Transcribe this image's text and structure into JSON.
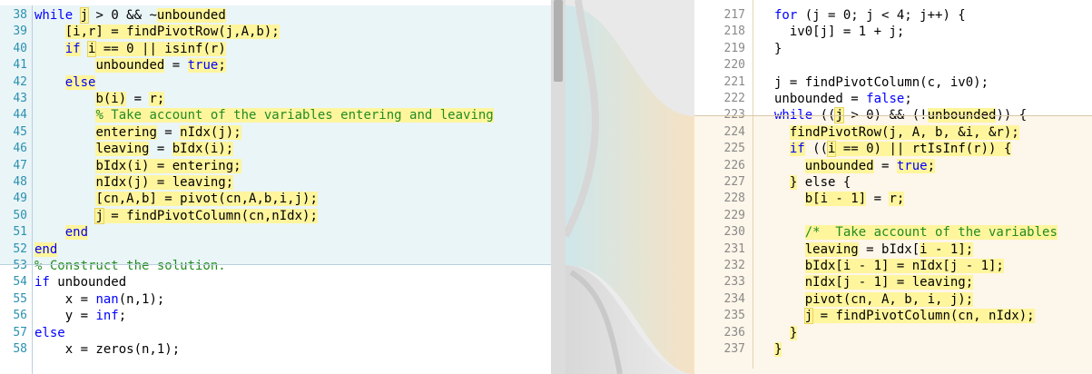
{
  "left_pane": {
    "lines": [
      {
        "n": "38",
        "parts": [
          {
            "t": "while",
            "c": "kw"
          },
          {
            "t": " "
          },
          {
            "t": "j",
            "c": "y ol"
          },
          {
            "t": " > 0 && ~"
          },
          {
            "t": "unbounded",
            "c": "y"
          }
        ]
      },
      {
        "n": "39",
        "parts": [
          {
            "t": "    "
          },
          {
            "t": "[i,r] = findPivotRow(j,A,b);",
            "c": "y"
          }
        ]
      },
      {
        "n": "40",
        "parts": [
          {
            "t": "    "
          },
          {
            "t": "if",
            "c": "kw y"
          },
          {
            "t": " "
          },
          {
            "t": "i",
            "c": "y ol"
          },
          {
            "t": " == 0 || isinf(r)",
            "c": "y"
          }
        ]
      },
      {
        "n": "41",
        "parts": [
          {
            "t": "        "
          },
          {
            "t": "unbounded",
            "c": "y"
          },
          {
            "t": " = "
          },
          {
            "t": "true",
            "c": "kw y"
          },
          {
            "t": ";",
            "c": "y"
          }
        ]
      },
      {
        "n": "42",
        "parts": [
          {
            "t": "    "
          },
          {
            "t": "else",
            "c": "kw y"
          }
        ]
      },
      {
        "n": "43",
        "parts": [
          {
            "t": "        "
          },
          {
            "t": "b(i)",
            "c": "y"
          },
          {
            "t": " = "
          },
          {
            "t": "r",
            "c": "y"
          },
          {
            "t": ";",
            "c": "y"
          }
        ]
      },
      {
        "n": "44",
        "parts": [
          {
            "t": "        "
          },
          {
            "t": "% Take account of the variables entering and leaving",
            "c": "cm y"
          }
        ]
      },
      {
        "n": "45",
        "parts": [
          {
            "t": "        "
          },
          {
            "t": "entering",
            "c": "y"
          },
          {
            "t": " = "
          },
          {
            "t": "nIdx(j)",
            "c": "y"
          },
          {
            "t": ";",
            "c": "y"
          }
        ]
      },
      {
        "n": "46",
        "parts": [
          {
            "t": "        "
          },
          {
            "t": "leaving",
            "c": "y"
          },
          {
            "t": " = "
          },
          {
            "t": "bIdx(i)",
            "c": "y"
          },
          {
            "t": ";",
            "c": "y"
          }
        ]
      },
      {
        "n": "47",
        "parts": [
          {
            "t": "        "
          },
          {
            "t": "bIdx(i) = entering;",
            "c": "y"
          }
        ]
      },
      {
        "n": "48",
        "parts": [
          {
            "t": "        "
          },
          {
            "t": "nIdx(j) = leaving;",
            "c": "y"
          }
        ]
      },
      {
        "n": "49",
        "parts": [
          {
            "t": "        "
          },
          {
            "t": "[cn,A,b] = pivot(cn,A,b,i,j);",
            "c": "y"
          }
        ]
      },
      {
        "n": "50",
        "parts": [
          {
            "t": "        "
          },
          {
            "t": "j",
            "c": "y ol"
          },
          {
            "t": " = findPivotColumn(cn,nIdx);",
            "c": "y"
          }
        ]
      },
      {
        "n": "51",
        "parts": [
          {
            "t": "    "
          },
          {
            "t": "end",
            "c": "kw y"
          }
        ]
      },
      {
        "n": "52",
        "parts": [
          {
            "t": "end",
            "c": "kw y"
          }
        ]
      },
      {
        "n": "53",
        "parts": [
          {
            "t": "% Construct the solution.",
            "c": "cm"
          }
        ]
      },
      {
        "n": "54",
        "parts": [
          {
            "t": "if",
            "c": "kw"
          },
          {
            "t": " unbounded"
          }
        ]
      },
      {
        "n": "55",
        "parts": [
          {
            "t": "    x = "
          },
          {
            "t": "nan",
            "c": "kw"
          },
          {
            "t": "(n,1);"
          }
        ]
      },
      {
        "n": "56",
        "parts": [
          {
            "t": "    y = "
          },
          {
            "t": "inf",
            "c": "kw"
          },
          {
            "t": ";"
          }
        ]
      },
      {
        "n": "57",
        "parts": [
          {
            "t": "else",
            "c": "kw"
          }
        ]
      },
      {
        "n": "58",
        "parts": [
          {
            "t": "    x = zeros(n,1);"
          }
        ]
      }
    ]
  },
  "right_pane": {
    "lines": [
      {
        "n": "217",
        "parts": [
          {
            "t": "for",
            "c": "kw"
          },
          {
            "t": " (j = 0; j < 4; j++) {"
          }
        ]
      },
      {
        "n": "218",
        "parts": [
          {
            "t": "  iv0[j] = 1 + j;"
          }
        ]
      },
      {
        "n": "219",
        "parts": [
          {
            "t": "}"
          }
        ]
      },
      {
        "n": "220",
        "parts": [
          {
            "t": ""
          }
        ]
      },
      {
        "n": "221",
        "parts": [
          {
            "t": "j = findPivotColumn(c, iv0);"
          }
        ]
      },
      {
        "n": "222",
        "parts": [
          {
            "t": "unbounded = "
          },
          {
            "t": "false",
            "c": "kw"
          },
          {
            "t": ";"
          }
        ]
      },
      {
        "n": "223",
        "parts": [
          {
            "t": "while",
            "c": "kw"
          },
          {
            "t": " (("
          },
          {
            "t": "j",
            "c": "y ol"
          },
          {
            "t": " > 0) && (!"
          },
          {
            "t": "unbounded",
            "c": "y"
          },
          {
            "t": ")) {"
          }
        ]
      },
      {
        "n": "224",
        "parts": [
          {
            "t": "  "
          },
          {
            "t": "findPivotRow(j, A, b, &i, &r);",
            "c": "y"
          }
        ]
      },
      {
        "n": "225",
        "parts": [
          {
            "t": "  "
          },
          {
            "t": "if",
            "c": "kw y"
          },
          {
            "t": " (("
          },
          {
            "t": "i",
            "c": "y ol"
          },
          {
            "t": " == 0) || rtIsInf(r)) {",
            "c": "y"
          }
        ]
      },
      {
        "n": "226",
        "parts": [
          {
            "t": "    "
          },
          {
            "t": "unbounded",
            "c": "y"
          },
          {
            "t": " = "
          },
          {
            "t": "true",
            "c": "kw y"
          },
          {
            "t": ";",
            "c": "y"
          }
        ]
      },
      {
        "n": "227",
        "parts": [
          {
            "t": "  "
          },
          {
            "t": "}",
            "c": "y"
          },
          {
            "t": " else {"
          }
        ]
      },
      {
        "n": "228",
        "parts": [
          {
            "t": "    "
          },
          {
            "t": "b[i - 1]",
            "c": "y"
          },
          {
            "t": " = "
          },
          {
            "t": "r",
            "c": "y"
          },
          {
            "t": ";",
            "c": "y"
          }
        ]
      },
      {
        "n": "229",
        "parts": [
          {
            "t": ""
          }
        ]
      },
      {
        "n": "230",
        "parts": [
          {
            "t": "    "
          },
          {
            "t": "/*  Take account of the variables",
            "c": "cm y"
          }
        ]
      },
      {
        "n": "231",
        "parts": [
          {
            "t": "    "
          },
          {
            "t": "leaving",
            "c": "y"
          },
          {
            "t": " = bIdx["
          },
          {
            "t": "i",
            "c": "y"
          },
          {
            "t": " - 1];",
            "c": "y"
          }
        ]
      },
      {
        "n": "232",
        "parts": [
          {
            "t": "    "
          },
          {
            "t": "bIdx[i - 1] = nIdx[j - 1];",
            "c": "y"
          }
        ]
      },
      {
        "n": "233",
        "parts": [
          {
            "t": "    "
          },
          {
            "t": "nIdx[j - 1] = leaving;",
            "c": "y"
          }
        ]
      },
      {
        "n": "234",
        "parts": [
          {
            "t": "    "
          },
          {
            "t": "pivot(cn, A, b, i, j);",
            "c": "y"
          }
        ]
      },
      {
        "n": "235",
        "parts": [
          {
            "t": "    "
          },
          {
            "t": "j",
            "c": "y ol"
          },
          {
            "t": " = findPivotColumn(cn, nIdx);",
            "c": "y"
          }
        ]
      },
      {
        "n": "236",
        "parts": [
          {
            "t": "  "
          },
          {
            "t": "}",
            "c": "y"
          }
        ]
      },
      {
        "n": "237",
        "parts": [
          {
            "t": "}",
            "c": "y"
          }
        ]
      }
    ]
  },
  "colors": {
    "keyword": "#0000ff",
    "comment": "#228b22",
    "highlight": "#fff59c",
    "left_tint": "#eaf5f8",
    "right_tint": "#fdf6ea"
  }
}
